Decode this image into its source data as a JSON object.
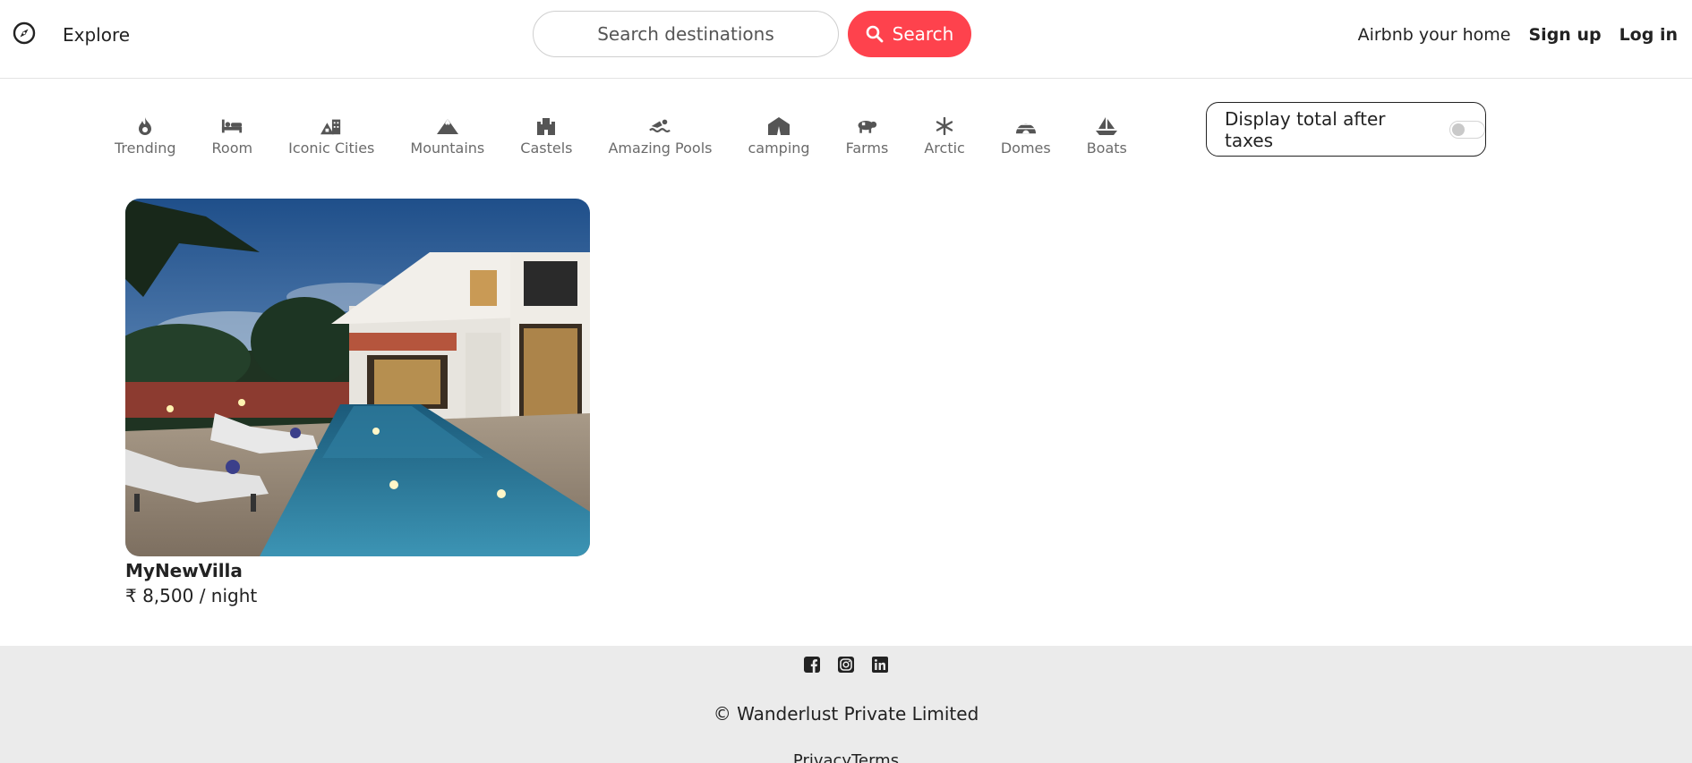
{
  "navbar": {
    "explore_label": "Explore",
    "search_placeholder": "Search destinations",
    "search_button_label": "Search",
    "host_link": "Airbnb your home",
    "signup_link": "Sign up",
    "login_link": "Log in",
    "brand_color": "#fe424d"
  },
  "filters": [
    {
      "label": "Trending",
      "icon": "fire-icon"
    },
    {
      "label": "Room",
      "icon": "bed-icon"
    },
    {
      "label": "Iconic Cities",
      "icon": "city-icon"
    },
    {
      "label": "Mountains",
      "icon": "mountain-icon"
    },
    {
      "label": "Castels",
      "icon": "castle-icon"
    },
    {
      "label": "Amazing Pools",
      "icon": "swimmer-icon"
    },
    {
      "label": "camping",
      "icon": "tent-icon"
    },
    {
      "label": "Farms",
      "icon": "cow-icon"
    },
    {
      "label": "Arctic",
      "icon": "snowflake-icon"
    },
    {
      "label": "Domes",
      "icon": "igloo-icon"
    },
    {
      "label": "Boats",
      "icon": "sailboat-icon"
    }
  ],
  "tax_toggle": {
    "label": "Display total after taxes",
    "enabled": false
  },
  "listing": {
    "title": "MyNewVilla",
    "price": "₹ 8,500 / night"
  },
  "footer": {
    "copyright": "© Wanderlust Private Limited",
    "privacy": "Privacy",
    "terms": "Terms",
    "social_icons": [
      "facebook-icon",
      "instagram-icon",
      "linkedin-icon"
    ]
  }
}
